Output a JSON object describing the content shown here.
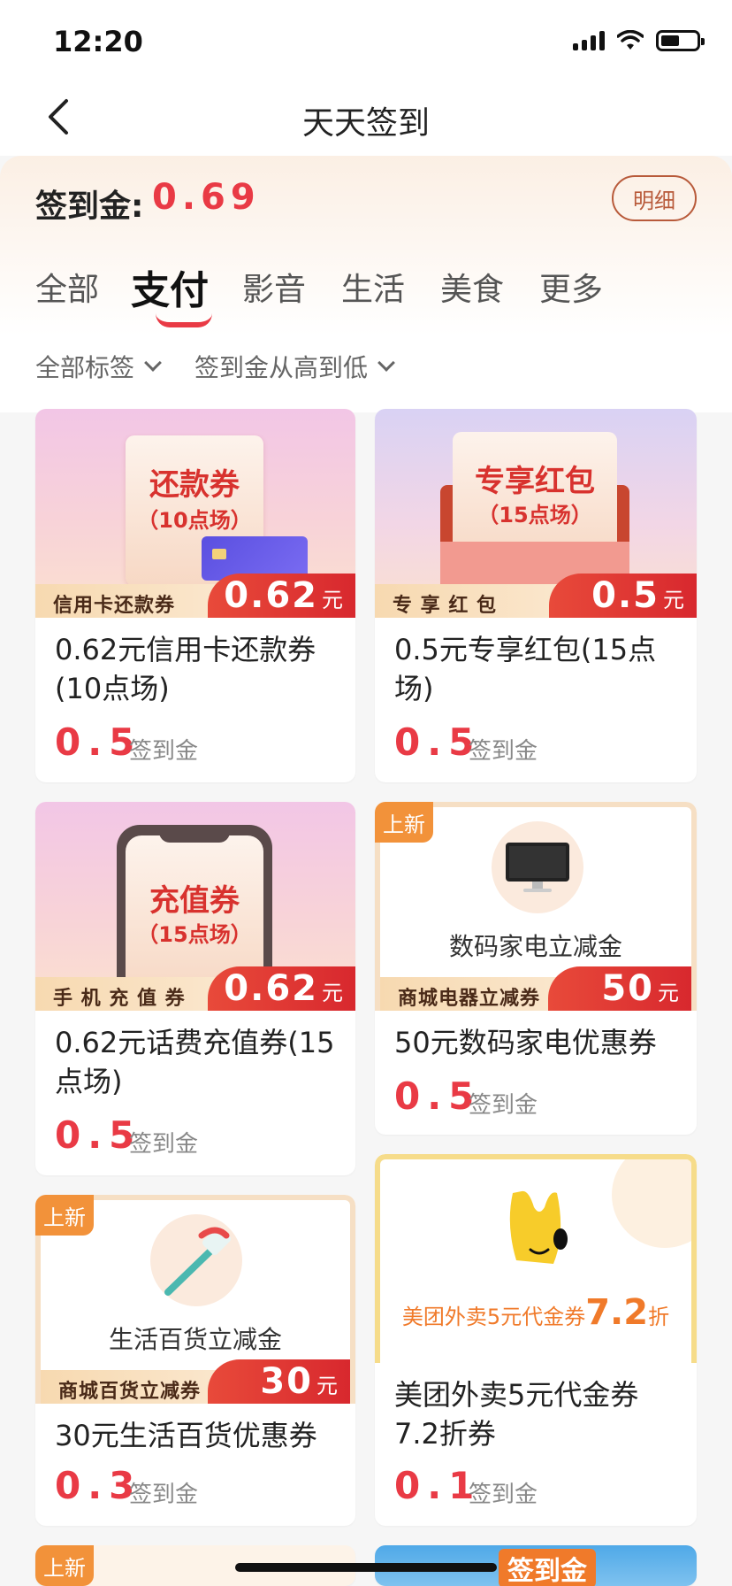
{
  "status_bar": {
    "time": "12:20"
  },
  "nav": {
    "title": "天天签到"
  },
  "header": {
    "gold_label": "签到金:",
    "gold_value": "0.69",
    "detail_button": "明细"
  },
  "tabs": [
    {
      "label": "全部"
    },
    {
      "label": "支付"
    },
    {
      "label": "影音"
    },
    {
      "label": "生活"
    },
    {
      "label": "美食"
    },
    {
      "label": "更多"
    }
  ],
  "active_tab": "支付",
  "filters": [
    {
      "label": "全部标签"
    },
    {
      "label": "签到金从高到低"
    }
  ],
  "cards": [
    {
      "banner_text": "还款券",
      "banner_sub": "（10点场）",
      "tag_name": "信用卡还款券",
      "tag_value": "0.62",
      "tag_unit": "元",
      "title": "0.62元信用卡还款券(10点场)",
      "price": "0.5",
      "price_unit": "签到金"
    },
    {
      "banner_text": "专享红包",
      "banner_sub": "（15点场）",
      "tag_name": "专 享 红 包",
      "tag_value": "0.5",
      "tag_unit": "元",
      "title": "0.5元专享红包(15点场)",
      "price": "0.5",
      "price_unit": "签到金"
    },
    {
      "banner_text": "充值券",
      "banner_sub": "（15点场）",
      "tag_name": "手 机 充 值 券",
      "tag_value": "0.62",
      "tag_unit": "元",
      "title": "0.62元话费充值券(15点场)",
      "price": "0.5",
      "price_unit": "签到金"
    },
    {
      "badge": "上新",
      "banner_text": "数码家电立减金",
      "tag_name": "商城电器立减券",
      "tag_value": "50",
      "tag_unit": "元",
      "title": "50元数码家电优惠券",
      "price": "0.5",
      "price_unit": "签到金"
    },
    {
      "badge": "上新",
      "banner_text": "生活百货立减金",
      "tag_name": "商城百货立减券",
      "tag_value": "30",
      "tag_unit": "元",
      "title": "30元生活百货优惠券",
      "price": "0.3",
      "price_unit": "签到金"
    },
    {
      "banner_text": "美团外卖5元代金券",
      "banner_discount": "7.2",
      "banner_discount_unit": "折",
      "title": "美团外卖5元代金券7.2折券",
      "price": "0.1",
      "price_unit": "签到金"
    },
    {
      "badge": "上新"
    },
    {
      "banner_text": "签到金"
    }
  ],
  "colors": {
    "accent": "#e93a45",
    "tag_red": "#d8282e",
    "tag_gold": "#f7d9b0",
    "detail_border": "#b85a3a",
    "badge": "#f2923a"
  }
}
